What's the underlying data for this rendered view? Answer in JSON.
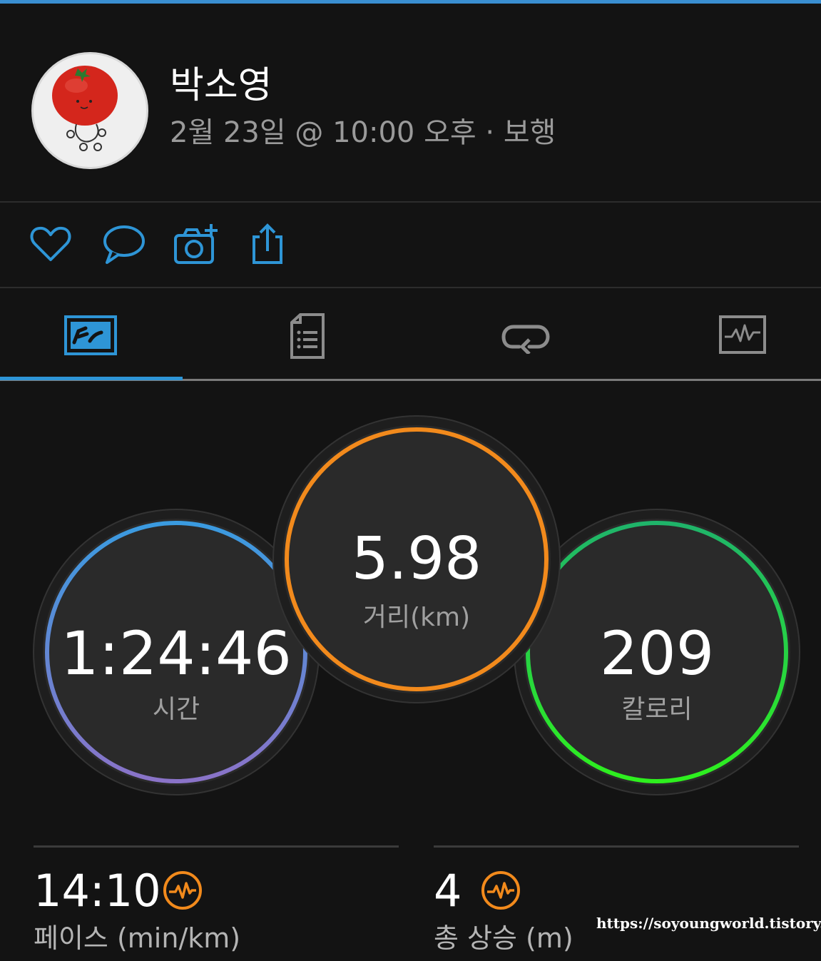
{
  "profile": {
    "name": "박소영",
    "meta": "2월 23일 @ 10:00 오후 · 보행"
  },
  "actions": [
    {
      "icon": "heart-icon"
    },
    {
      "icon": "comment-icon"
    },
    {
      "icon": "add-photo-icon"
    },
    {
      "icon": "share-icon"
    }
  ],
  "tabs": [
    {
      "icon": "map-stats-icon",
      "active": true
    },
    {
      "icon": "details-list-icon",
      "active": false
    },
    {
      "icon": "laps-icon",
      "active": false
    },
    {
      "icon": "chart-icon",
      "active": false
    }
  ],
  "stats": {
    "time": {
      "value": "1:24:46",
      "label": "시간"
    },
    "distance": {
      "value": "5.98",
      "label": "거리(km)"
    },
    "calories": {
      "value": "209",
      "label": "칼로리"
    }
  },
  "bottom": {
    "pace": {
      "value": "14:10",
      "label": "페이스 (min/km)"
    },
    "ascent": {
      "value": "4",
      "label": "총 상승 (m)"
    }
  },
  "watermark": "https://soyoungworld.tistory.com",
  "colors": {
    "accent": "#2e95d6",
    "distance_ring": "#f28a1c",
    "calories_ring_top": "#1fb46a",
    "calories_ring_bottom": "#2ef01e",
    "time_ring_top": "#3a9be0",
    "time_ring_bottom": "#8a73c8",
    "hr_icon": "#f28a1c"
  }
}
